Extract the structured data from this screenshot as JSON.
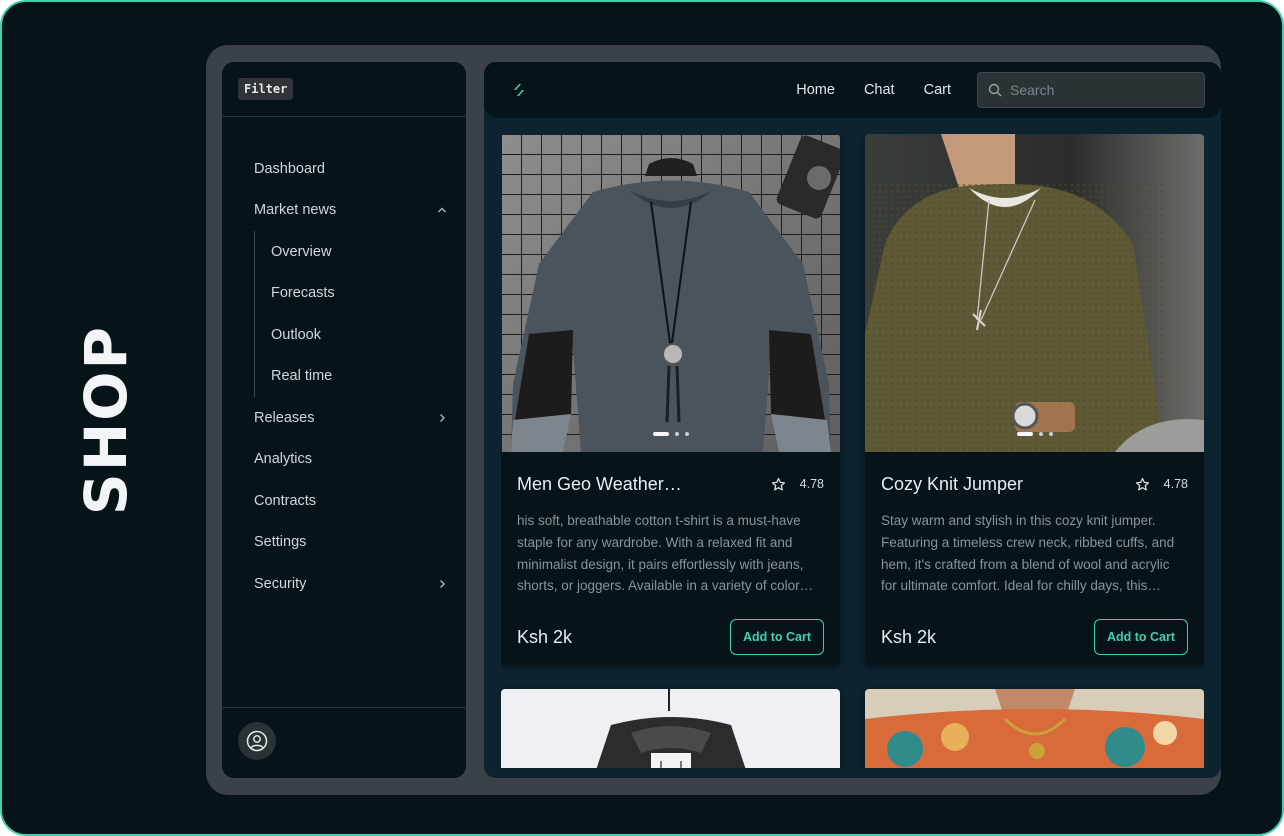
{
  "brand": "SHOP",
  "sidebar": {
    "filter_label": "Filter",
    "items": [
      {
        "label": "Dashboard"
      },
      {
        "label": "Market news"
      },
      {
        "label": "Releases"
      },
      {
        "label": "Analytics"
      },
      {
        "label": "Contracts"
      },
      {
        "label": "Settings"
      },
      {
        "label": "Security"
      }
    ],
    "market_news_children": [
      {
        "label": "Overview"
      },
      {
        "label": "Forecasts"
      },
      {
        "label": "Outlook"
      },
      {
        "label": "Real time"
      }
    ]
  },
  "topbar": {
    "links": [
      {
        "label": "Home"
      },
      {
        "label": "Chat"
      },
      {
        "label": "Cart"
      }
    ],
    "search_placeholder": "Search"
  },
  "products": [
    {
      "title": "Men Geo Weather…",
      "rating": "4.78",
      "description": "his soft, breathable cotton t-shirt is a must-have staple for any wardrobe. With a relaxed fit and minimalist design, it pairs effortlessly with jeans, shorts, or joggers. Available in a variety of color…",
      "price": "Ksh 2k",
      "cta": "Add to Cart"
    },
    {
      "title": "Cozy Knit Jumper",
      "rating": "4.78",
      "description": "Stay warm and stylish in this cozy knit jumper. Featuring a timeless crew neck, ribbed cuffs, and hem, it's crafted from a blend of wool and acrylic for ultimate comfort. Ideal for chilly days, this…",
      "price": "Ksh 2k",
      "cta": "Add to Cart"
    }
  ],
  "colors": {
    "accent": "#3fd0b0",
    "background": "#061319",
    "panel": "#0e2330"
  }
}
